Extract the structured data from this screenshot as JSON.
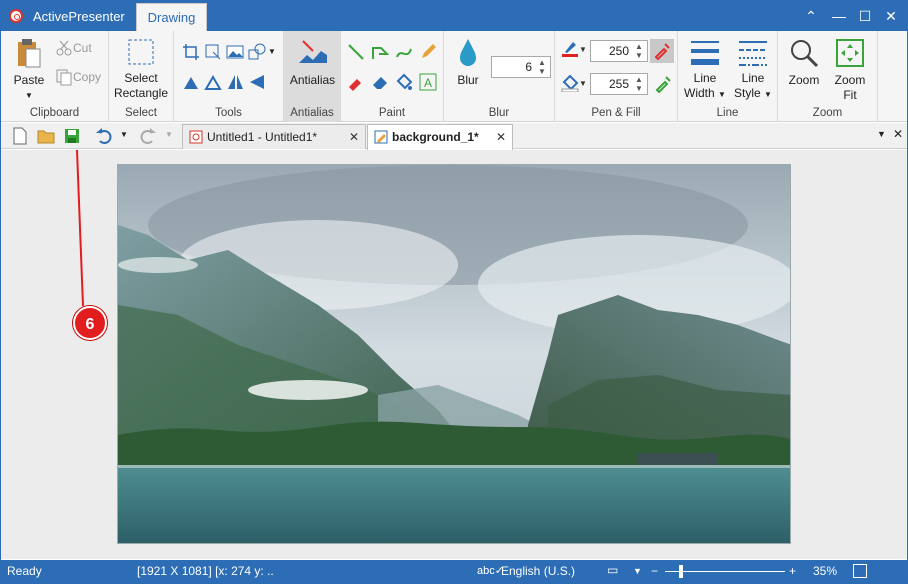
{
  "titlebar": {
    "app_name": "ActivePresenter",
    "ribbon_tab": "Drawing",
    "minimize": "—",
    "maximize": "☐",
    "close": "✕",
    "collapse": "⌃"
  },
  "ribbon": {
    "clipboard": {
      "label": "Clipboard",
      "paste": "Paste",
      "cut": "Cut",
      "copy": "Copy"
    },
    "select": {
      "label": "Select",
      "select_rectangle_line1": "Select",
      "select_rectangle_line2": "Rectangle"
    },
    "tools": {
      "label": "Tools"
    },
    "antialias": {
      "label": "Antialias",
      "button": "Antialias"
    },
    "paint": {
      "label": "Paint"
    },
    "blur": {
      "label": "Blur",
      "button": "Blur",
      "value": "6"
    },
    "pen_fill": {
      "label": "Pen & Fill",
      "pen_value": "250",
      "fill_value": "255",
      "pen_color": "#e02020"
    },
    "line": {
      "label": "Line",
      "line_width_1": "Line",
      "line_width_2": "Width",
      "line_style_1": "Line",
      "line_style_2": "Style"
    },
    "zoom": {
      "label": "Zoom",
      "zoom": "Zoom",
      "zoom_fit_1": "Zoom",
      "zoom_fit_2": "Fit"
    }
  },
  "tabs": [
    {
      "label": "Untitled1 - Untitled1*",
      "close": "✕"
    },
    {
      "label": "background_1*",
      "close": "✕"
    }
  ],
  "callout": "6",
  "status": {
    "ready": "Ready",
    "coords": "[1921 X 1081] [x: 274 y: ..",
    "language": "English (U.S.)",
    "zoom": "35%",
    "zoom_minus": "−",
    "zoom_plus": "+"
  }
}
